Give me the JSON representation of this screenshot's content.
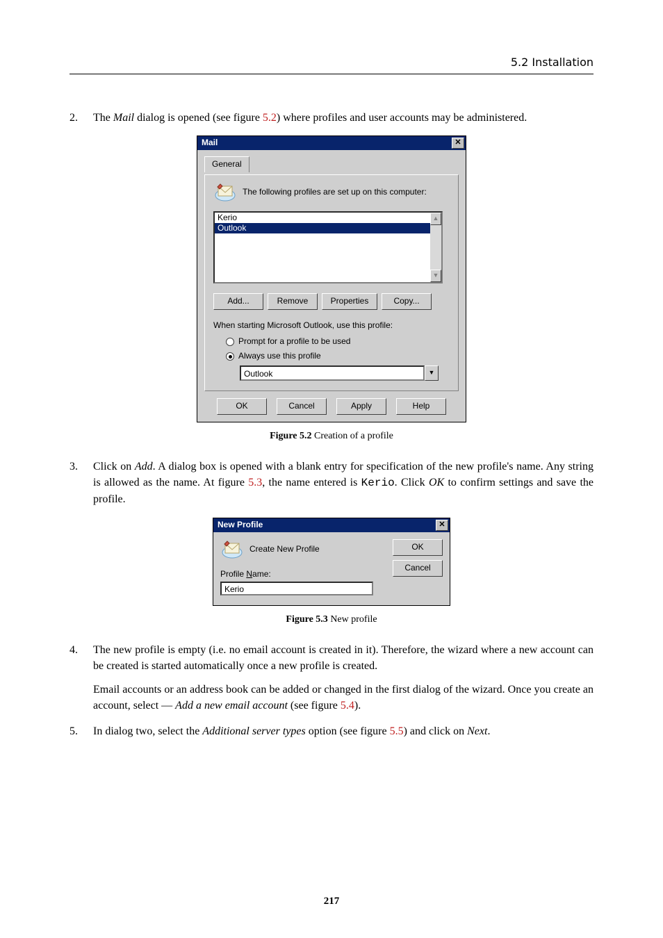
{
  "running_head": "5.2  Installation",
  "page_number": "217",
  "para2": {
    "num": "2.",
    "t1": "The ",
    "mail": "Mail",
    "t2": " dialog is opened (see figure ",
    "figref": "5.2",
    "t3": ") where profiles and user accounts may be administered."
  },
  "mail_dialog": {
    "title": "Mail",
    "tab": "General",
    "desc": "The following profiles are set up on this computer:",
    "list": [
      "Kerio",
      "Outlook"
    ],
    "selected_index": 1,
    "buttons": {
      "add": "Add...",
      "remove": "Remove",
      "props": "Properties",
      "copy": "Copy..."
    },
    "section_label": "When starting Microsoft Outlook, use this profile:",
    "radio_prompt": "Prompt for a profile to be used",
    "radio_always": "Always use this profile",
    "radio_selected": "always",
    "combo_value": "Outlook",
    "bottom": {
      "ok": "OK",
      "cancel": "Cancel",
      "apply": "Apply",
      "help": "Help"
    }
  },
  "caption52": {
    "label": "Figure 5.2",
    "text": "   Creation of a profile"
  },
  "para3": {
    "num": "3.",
    "t1": "Click on ",
    "add": "Add",
    "t2": ".  A dialog box is opened with a blank entry for specification of the new profile's name.  Any string is allowed as the name.  At figure ",
    "figref": "5.3",
    "t3": ", the name entered is ",
    "code": "Kerio",
    "t4": ". Click ",
    "ok": "OK",
    "t5": " to confirm settings and save the profile."
  },
  "np_dialog": {
    "title": "New Profile",
    "create_label": "Create New Profile",
    "name_label_pre": "Profile ",
    "name_label_u": "N",
    "name_label_post": "ame:",
    "name_value": "Kerio",
    "ok": "OK",
    "cancel": "Cancel"
  },
  "caption53": {
    "label": "Figure 5.3",
    "text": "   New profile"
  },
  "para4": {
    "num": "4.",
    "t1": "The new profile is empty (i.e.  no email account is created in it).  Therefore, the wizard where a new account can be created is started automatically once a new profile is created.",
    "t2a": "Email accounts or an address book can be added or changed in the first dialog of the wizard. Once you create an account, select — ",
    "addnew": "Add a new email account",
    "t2b": " (see figure ",
    "figref": "5.4",
    "t2c": ")."
  },
  "para5": {
    "num": "5.",
    "t1": "In dialog two, select the ",
    "opt": "Additional server types",
    "t2": " option (see figure ",
    "figref": "5.5",
    "t3": ") and click on ",
    "next": "Next",
    "t4": "."
  }
}
